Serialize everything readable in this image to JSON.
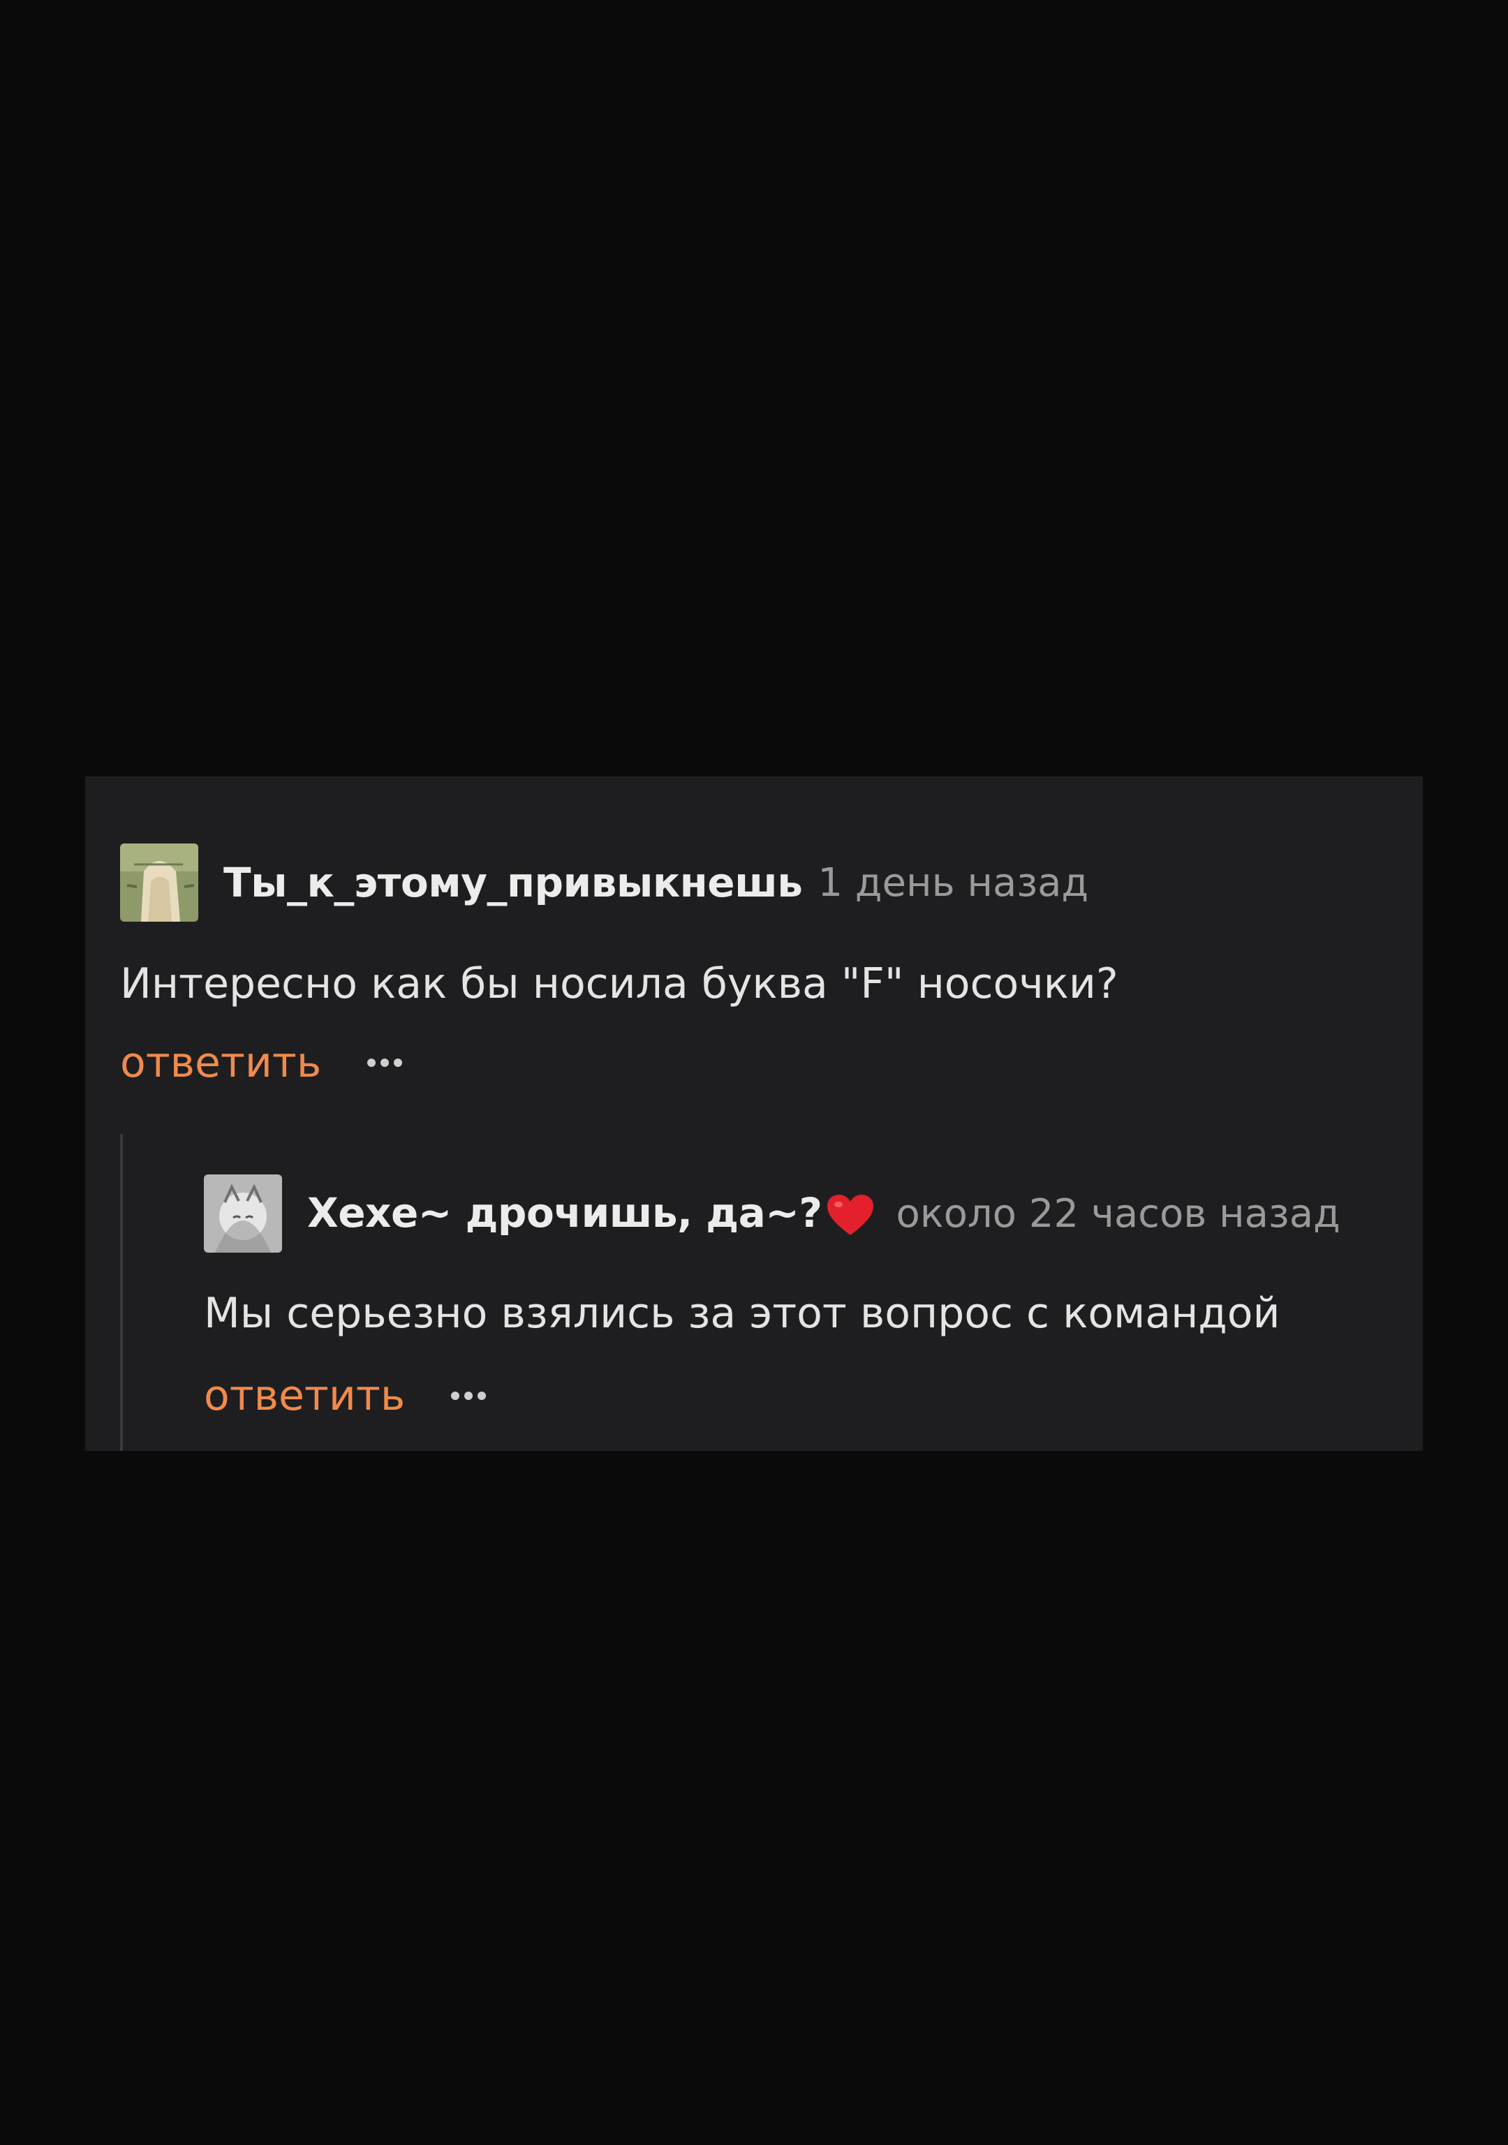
{
  "comments": [
    {
      "author": "Ты_к_этому_привыкнешь",
      "time": "1 день назад",
      "text": "Интересно как бы носила буква \"F\" носочки?",
      "reply_label": "ответить"
    },
    {
      "author": "Хехе~ дрочишь, да~?",
      "time": "около 22 часов назад",
      "text": "Мы серьезно взялись за этот вопрос с командой",
      "reply_label": "ответить"
    }
  ],
  "colors": {
    "page_background": "#0a0a0a",
    "panel_background": "#1e1e20",
    "reply_accent": "#f08a4b",
    "author_text": "#ececec",
    "time_text": "#9a9a9a"
  }
}
